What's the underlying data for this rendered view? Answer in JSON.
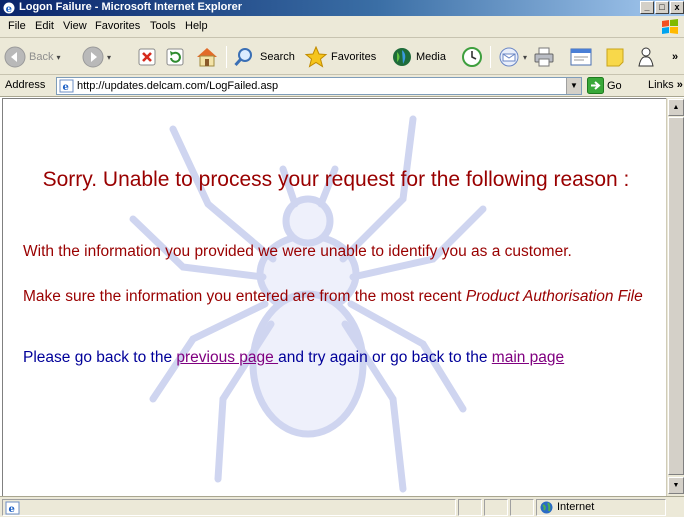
{
  "window": {
    "title": "Logon Failure - Microsoft Internet Explorer",
    "buttons": {
      "minimize": "_",
      "maximize": "□",
      "close": "x"
    }
  },
  "menu": [
    "File",
    "Edit",
    "View",
    "Favorites",
    "Tools",
    "Help"
  ],
  "toolbar": {
    "back": "Back",
    "search": "Search",
    "favorites": "Favorites",
    "media": "Media"
  },
  "address": {
    "label": "Address",
    "url": "http://updates.delcam.com/LogFailed.asp",
    "go": "Go",
    "links": "Links",
    "more": "»"
  },
  "page": {
    "heading": "Sorry. Unable to process your request for the following reason :",
    "reason": "With the information you provided we were unable to identify you as a customer.",
    "hint_prefix": "Make sure  the information you entered are from the most recent ",
    "hint_emphasis": "Product Authorisation File",
    "goback_prefix": "Please go back to the ",
    "previous_page_link": "previous page ",
    "goback_middle": "and try again or go back to the ",
    "main_page_link": "main page"
  },
  "status": {
    "zone": "Internet"
  },
  "colors": {
    "error_text": "#990000",
    "info_text": "#000099",
    "visited_link": "#800080",
    "titlebar_start": "#0a246a"
  }
}
